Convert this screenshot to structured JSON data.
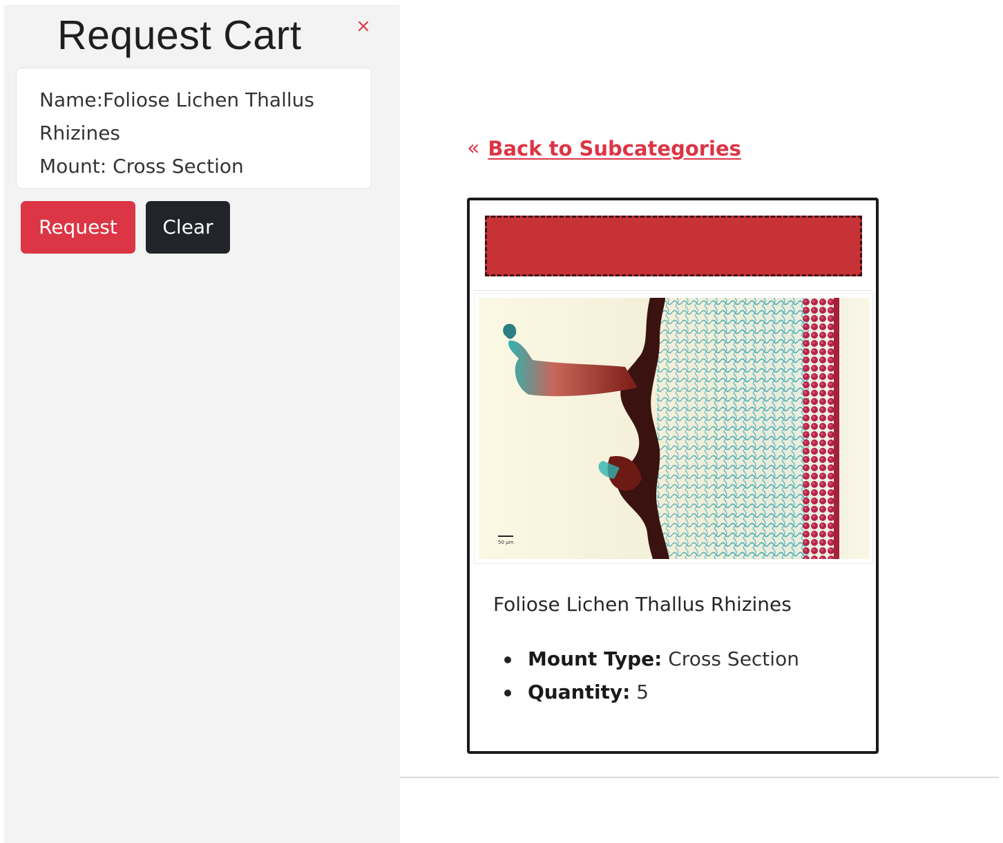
{
  "cart": {
    "title": "Request Cart",
    "close_label": "×",
    "item": {
      "name_line_1": "Name:Foliose Lichen Thallus",
      "name_line_2": "Rhizines",
      "mount_line": "Mount: Cross Section"
    },
    "request_label": "Request",
    "clear_label": "Clear"
  },
  "nav": {
    "back_icon": "«",
    "back_label": "Back to Subcategories"
  },
  "product": {
    "banner_color": "#c73236",
    "image_icon": "micrograph-image",
    "image_scale_label": "50 µm",
    "name": "Foliose Lichen Thallus Rhizines",
    "specs": [
      {
        "label": "Mount Type:",
        "value": " Cross Section"
      },
      {
        "label": "Quantity:",
        "value": " 5"
      }
    ]
  },
  "colors": {
    "accent": "#dc3545",
    "dark": "#212529",
    "sidebar_bg": "#f3f3f3"
  }
}
